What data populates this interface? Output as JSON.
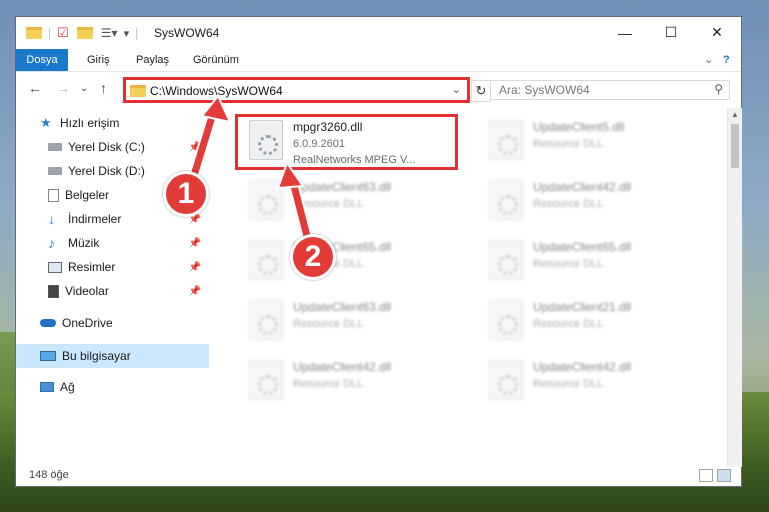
{
  "window": {
    "title": "SysWOW64"
  },
  "ribbon": {
    "tabs": [
      "Dosya",
      "Giriş",
      "Paylaş",
      "Görünüm"
    ]
  },
  "address": {
    "path": "C:\\Windows\\SysWOW64"
  },
  "search": {
    "placeholder": "Ara: SysWOW64"
  },
  "sidebar": {
    "items": [
      {
        "label": "Hızlı erişim",
        "icon": "star-icon"
      },
      {
        "label": "Yerel Disk (C:)",
        "icon": "drive-icon"
      },
      {
        "label": "Yerel Disk (D:)",
        "icon": "drive-icon"
      },
      {
        "label": "Belgeler",
        "icon": "document-icon"
      },
      {
        "label": "İndirmeler",
        "icon": "download-icon"
      },
      {
        "label": "Müzik",
        "icon": "music-icon"
      },
      {
        "label": "Resimler",
        "icon": "pictures-icon"
      },
      {
        "label": "Videolar",
        "icon": "video-icon"
      },
      {
        "label": "OneDrive",
        "icon": "cloud-icon"
      },
      {
        "label": "Bu bilgisayar",
        "icon": "computer-icon"
      },
      {
        "label": "Ağ",
        "icon": "network-icon"
      }
    ]
  },
  "files": [
    {
      "name": "mpgr3260.dll",
      "version": "6.0.9.2601",
      "desc": "RealNetworks MPEG V..."
    },
    {
      "name": "UpdateClient5.dll",
      "desc": "Resource DLL"
    },
    {
      "name": "UpdateClient63.dll",
      "desc": "Resource DLL"
    },
    {
      "name": "UpdateClient42.dll",
      "desc": "Resource DLL"
    },
    {
      "name": "UpdateClient65.dll",
      "desc": "Resource DLL"
    },
    {
      "name": "UpdateClient65.dll",
      "desc": "Resource DLL"
    },
    {
      "name": "UpdateClient63.dll",
      "desc": "Resource DLL"
    },
    {
      "name": "UpdateClient21.dll",
      "desc": "Resource DLL"
    },
    {
      "name": "UpdateClient42.dll",
      "desc": "Resource DLL"
    },
    {
      "name": "UpdateClient42.dll",
      "desc": "Resource DLL"
    }
  ],
  "status": {
    "count": "148 öğe"
  },
  "annotations": {
    "step1": "1",
    "step2": "2"
  },
  "colors": {
    "accent": "#1979ca",
    "highlight": "#e03030",
    "selected": "#cce8ff"
  }
}
